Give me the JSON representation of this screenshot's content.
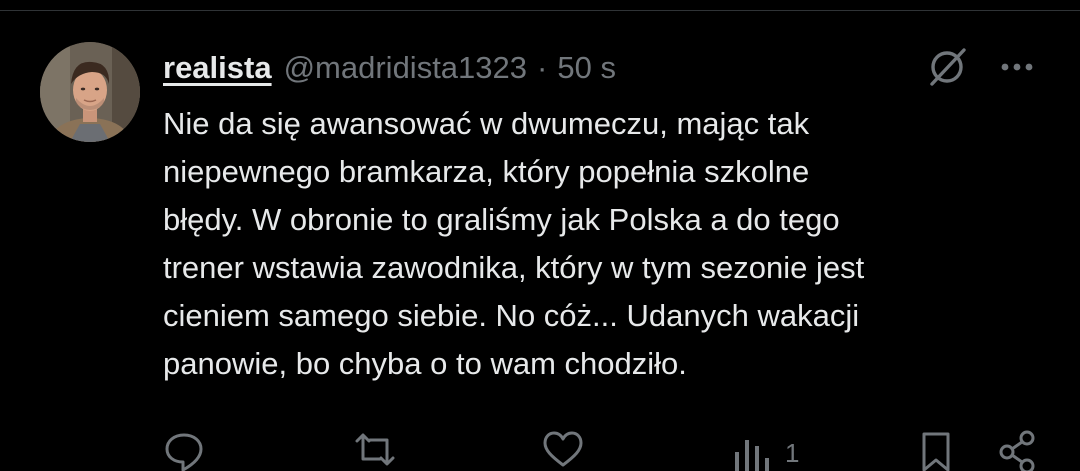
{
  "tweet": {
    "display_name": "realista",
    "handle": "@madridista1323",
    "separator": "·",
    "time": "50 s",
    "text": "Nie da się awansować w dwumeczu, mając tak\nniepewnego bramkarza, który popełnia szkolne\nbłędy. W obronie to graliśmy jak Polska a do tego\ntrener wstawia zawodnika, który w tym sezonie jest\ncieniem samego siebie. No cóż... Udanych wakacji\npanowie, bo chyba o to wam chodziło."
  },
  "header_icons": {
    "grok": "grok-icon",
    "more": "more-icon"
  },
  "actions": {
    "reply": {
      "icon": "reply-icon"
    },
    "retweet": {
      "icon": "retweet-icon"
    },
    "like": {
      "icon": "like-icon"
    },
    "views": {
      "icon": "views-icon",
      "count": "1"
    },
    "bookmark": {
      "icon": "bookmark-icon"
    },
    "share": {
      "icon": "share-icon"
    }
  },
  "colors": {
    "background": "#000000",
    "text": "#e7e9ea",
    "secondary": "#71767b",
    "divider": "#2f3336"
  }
}
